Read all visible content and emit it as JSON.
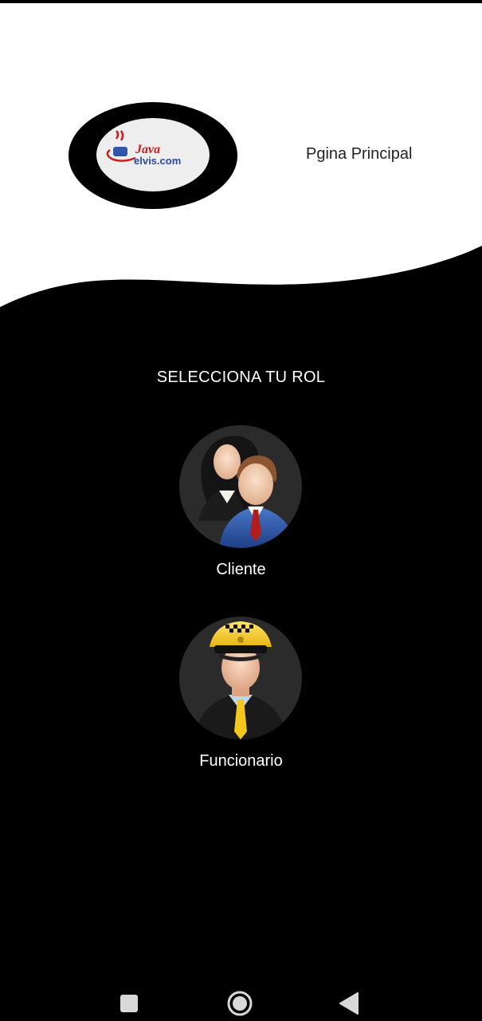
{
  "app": {
    "logo_text_line1": "Java",
    "logo_text_line2": "elvis.com",
    "page_title": "Pgina Principal"
  },
  "main": {
    "select_title": "SELECCIONA TU ROL",
    "roles": [
      {
        "label": "Cliente",
        "icon": "business-people-icon"
      },
      {
        "label": "Funcionario",
        "icon": "taxi-driver-icon"
      }
    ]
  },
  "navbar": {
    "recents": "recents-icon",
    "home": "home-icon",
    "back": "back-icon"
  },
  "colors": {
    "background": "#000000",
    "header": "#ffffff",
    "text_light": "#ffffff",
    "text_dark": "#222222",
    "avatar_bg": "#2b2b2b"
  }
}
